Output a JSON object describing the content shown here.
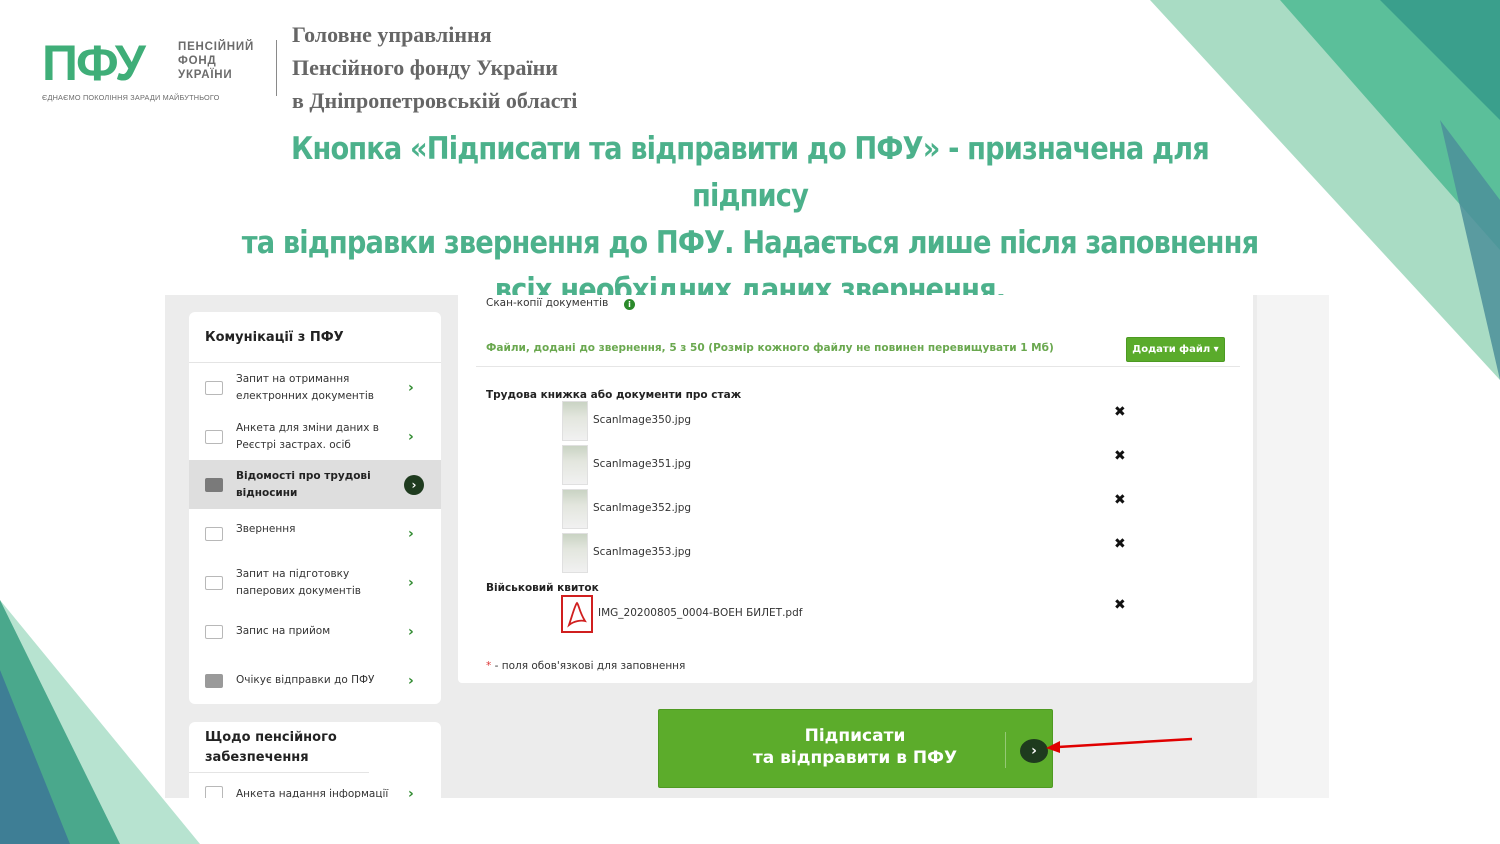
{
  "colors": {
    "accent_green": "#4cb18b",
    "button_green": "#5cac2b",
    "arrow_red": "#e00000"
  },
  "header": {
    "logo_text": "ПФУ",
    "logo_name_lines": [
      "ПЕНСІЙНИЙ",
      "ФОНД",
      "УКРАЇНИ"
    ],
    "logo_tagline": "ЄДНАЄМО ПОКОЛІННЯ ЗАРАДИ МАЙБУТНЬОГО",
    "org_lines": [
      "Головне управління",
      "Пенсійного фонду України",
      "в Дніпропетровській області"
    ]
  },
  "headline_lines": [
    "Кнопка «Підписати та відправити до ПФУ» - призначена для підпису",
    "та відправки звернення до ПФУ. Надається лише після заповнення",
    "всіх необхідних даних звернення."
  ],
  "sidebar": {
    "section_title": "Комунікації з ПФУ",
    "items": [
      {
        "label": "Запит на отримання електронних документів",
        "icon": "document-check-icon"
      },
      {
        "label": "Анкета для зміни даних в Реєстрі застрах. осіб",
        "icon": "document-check-icon"
      },
      {
        "label": "Відомості про трудові відносини",
        "icon": "folder-icon",
        "active": true
      },
      {
        "label": "Звернення",
        "icon": "envelope-icon"
      },
      {
        "label": "Запит на підготовку паперових документів",
        "icon": "printer-icon"
      },
      {
        "label": "Запис на прийом",
        "icon": "calendar-icon"
      },
      {
        "label": "Очікує відправки до ПФУ",
        "icon": "folder-icon"
      }
    ],
    "section2_title": "Щодо пенсійного забезпечення",
    "section2_items": [
      {
        "label": "Анкета надання інформації",
        "icon": "document-check-icon"
      }
    ]
  },
  "content": {
    "scans_label": "Скан-копії документів",
    "files_note": "Файли, додані до звернення, 5 з 50 (Розмір кожного файлу не повинен перевищувати 1 Мб)",
    "add_file_button": "Додати файл ▾",
    "groups": [
      {
        "title": "Трудова книжка або документи про стаж",
        "files": [
          "ScanImage350.jpg",
          "ScanImage351.jpg",
          "ScanImage352.jpg",
          "ScanImage353.jpg"
        ]
      },
      {
        "title": "Військовий квиток",
        "files": [
          "IMG_20200805_0004-ВОЕН БИЛЕТ.pdf"
        ]
      }
    ],
    "delete_symbol": "✖",
    "required_star": "*",
    "required_note": " - поля обов'язкові для заповнення"
  },
  "submit_button": {
    "line1": "Підписати",
    "line2": "та відправити в ПФУ",
    "arrow": "›"
  },
  "sidebar_arrow": "›"
}
